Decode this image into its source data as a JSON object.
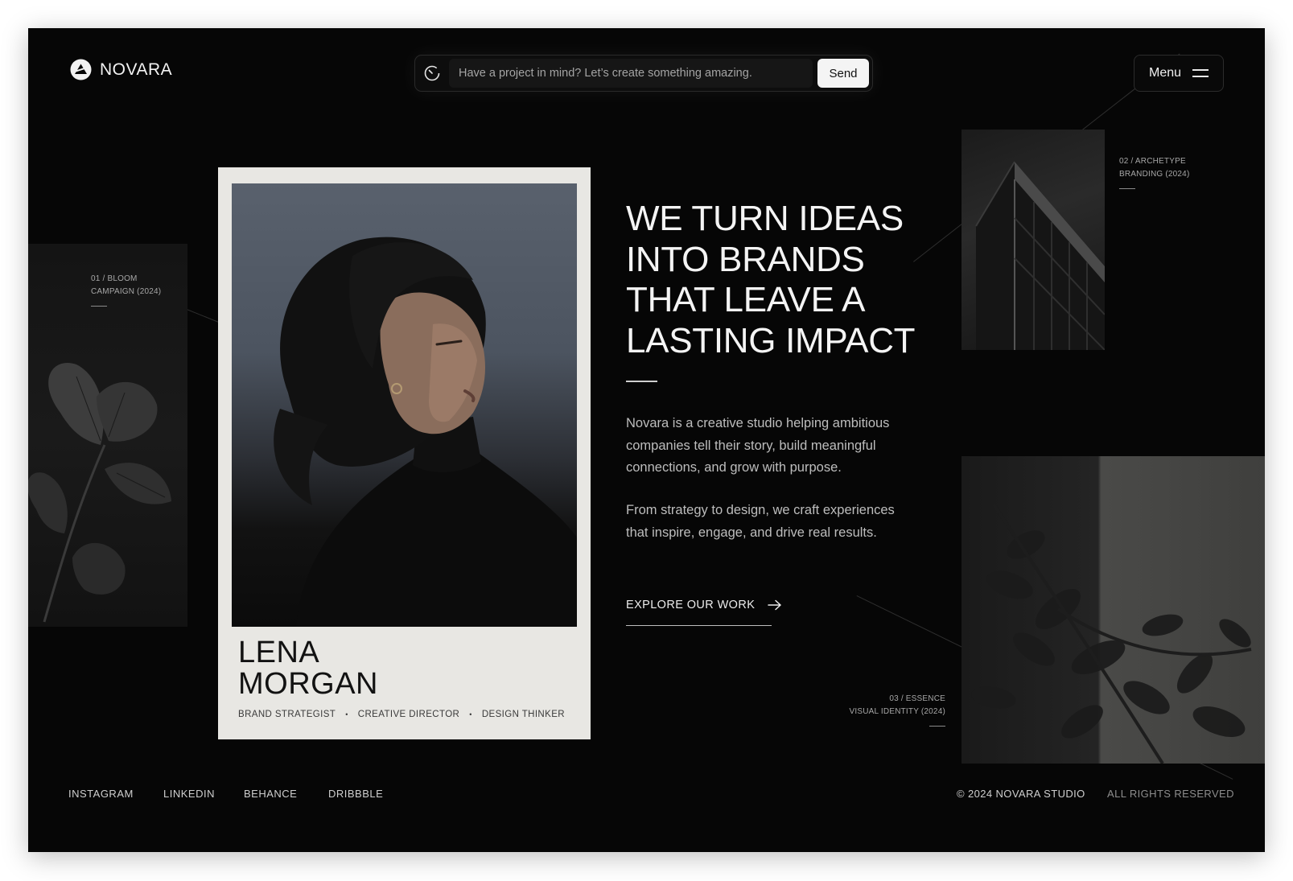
{
  "brand": {
    "name": "NOVARA"
  },
  "prompt_bar": {
    "placeholder": "Have a project in mind? Let’s create something amazing.",
    "send_label": "Send"
  },
  "menu": {
    "label": "Menu"
  },
  "projects": [
    {
      "line1": "01 / BLOOM",
      "line2": "CAMPAIGN (2024)"
    },
    {
      "line1": "02 / ARCHETYPE",
      "line2": "BRANDING (2024)"
    },
    {
      "line1": "03 / ESSENCE",
      "line2": "VISUAL IDENTITY (2024)"
    }
  ],
  "profile": {
    "first_name": "LENA",
    "last_name": "MORGAN",
    "roles": [
      "BRAND STRATEGIST",
      "CREATIVE DIRECTOR",
      "DESIGN THINKER"
    ],
    "role_separator": "•"
  },
  "hero": {
    "headline_lines": [
      "WE TURN IDEAS",
      "INTO BRANDS",
      "THAT LEAVE A",
      "LASTING IMPACT"
    ],
    "paragraph_1": "Novara is a creative studio helping ambitious companies tell their story, build meaningful connections, and grow with purpose.",
    "paragraph_2": "From strategy to design, we craft experiences that inspire, engage, and drive real results.",
    "cta_label": "EXPLORE OUR WORK"
  },
  "footer": {
    "links": [
      "INSTAGRAM",
      "LINKEDIN",
      "BEHANCE",
      "DRIBBBLE"
    ],
    "copyright": "© 2024 NOVARA STUDIO",
    "rights": "ALL RIGHTS RESERVED"
  },
  "colors": {
    "background": "#060606",
    "card": "#e8e7e3",
    "text_primary": "#f4f4f4",
    "text_secondary": "#bdbdbd"
  },
  "icons": {
    "logo": "novara-logo-icon",
    "prompt": "timer-icon",
    "menu": "hamburger-icon",
    "cta": "arrow-right-icon"
  }
}
